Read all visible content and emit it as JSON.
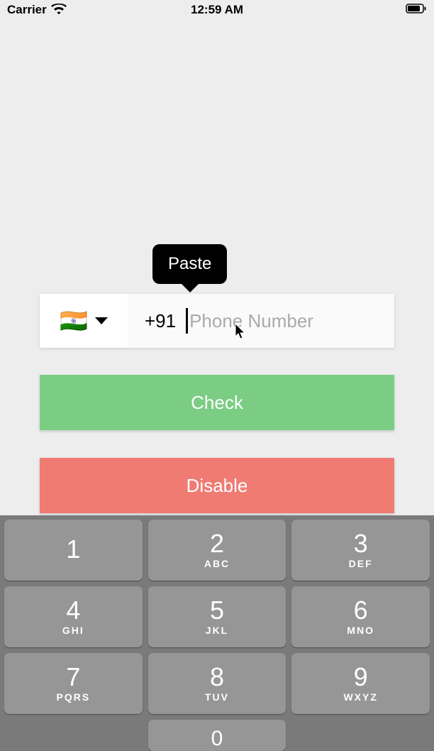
{
  "status_bar": {
    "carrier": "Carrier",
    "time": "12:59 AM"
  },
  "tooltip": {
    "paste": "Paste"
  },
  "phone_input": {
    "flag_emoji": "🇮🇳",
    "dial_code": "+91",
    "placeholder": "Phone Number",
    "value": ""
  },
  "buttons": {
    "check": "Check",
    "disable": "Disable"
  },
  "keyboard": {
    "rows": [
      [
        {
          "digit": "1",
          "letters": ""
        },
        {
          "digit": "2",
          "letters": "ABC"
        },
        {
          "digit": "3",
          "letters": "DEF"
        }
      ],
      [
        {
          "digit": "4",
          "letters": "GHI"
        },
        {
          "digit": "5",
          "letters": "JKL"
        },
        {
          "digit": "6",
          "letters": "MNO"
        }
      ],
      [
        {
          "digit": "7",
          "letters": "PQRS"
        },
        {
          "digit": "8",
          "letters": "TUV"
        },
        {
          "digit": "9",
          "letters": "WXYZ"
        }
      ],
      [
        {
          "digit": "",
          "letters": "",
          "blank": true
        },
        {
          "digit": "0",
          "letters": ""
        },
        {
          "digit": "",
          "letters": "",
          "blank": true
        }
      ]
    ]
  },
  "colors": {
    "check_button": "#7bcd84",
    "disable_button": "#ef7b73",
    "background": "#ededed",
    "keyboard_bg": "#7a7a7a",
    "key_bg": "#969696"
  }
}
